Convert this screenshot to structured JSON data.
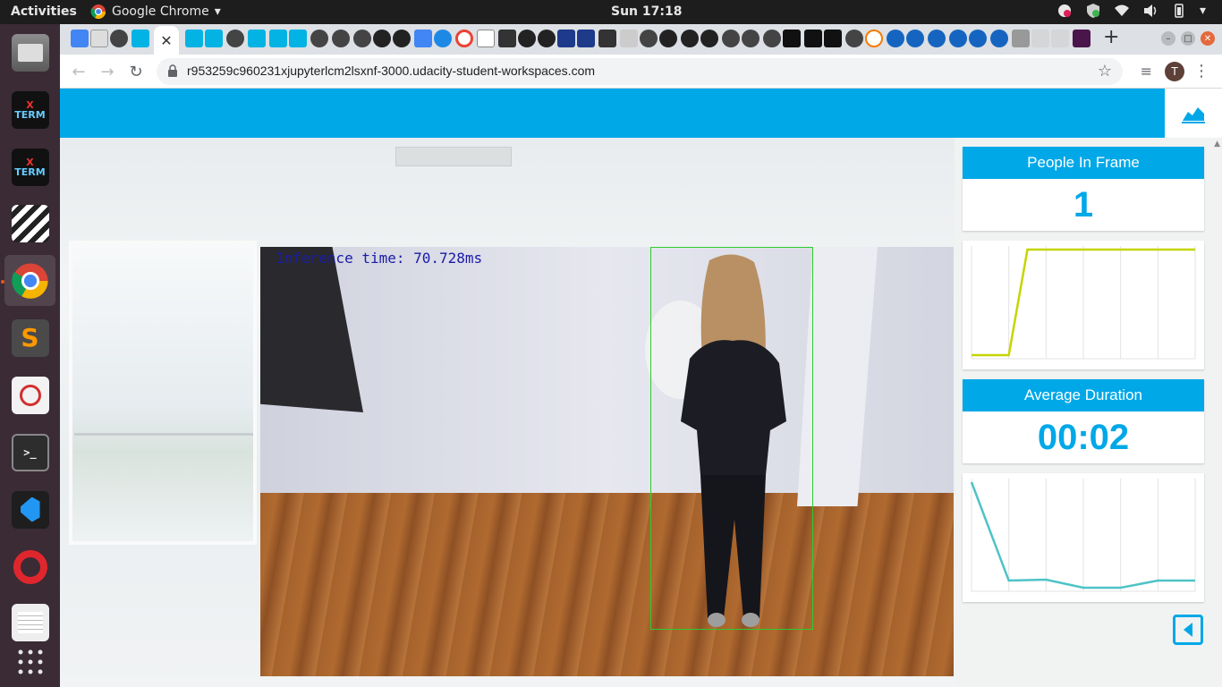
{
  "system": {
    "activities_label": "Activities",
    "app_name": "Google Chrome",
    "clock": "Sun 17:18"
  },
  "dock": {
    "items": [
      "Files",
      "XTerm",
      "XTerm",
      "Video Editor",
      "Google Chrome",
      "Sublime Text",
      "Document Viewer",
      "Terminal",
      "Visual Studio Code",
      "Opera",
      "Text Editor",
      "Show Applications"
    ],
    "xterm_label_top": "X",
    "xterm_label_bottom": "TERM"
  },
  "browser": {
    "current_tab_close": "✕",
    "new_tab": "+",
    "url": "r953259c960231xjupyterlcm2lsxnf-3000.udacity-student-workspaces.com",
    "profile_initial": "T"
  },
  "video": {
    "inference_text": "Inference time: 70.728ms"
  },
  "stats": {
    "people_title": "People In Frame",
    "people_value": "1",
    "duration_title": "Average Duration",
    "duration_value": "00:02"
  },
  "chart_data": [
    {
      "type": "line",
      "x": [
        0,
        1,
        2,
        3,
        4,
        5,
        6,
        7,
        8,
        9,
        10,
        11,
        12
      ],
      "values": [
        0,
        0,
        0,
        1,
        1,
        1,
        1,
        1,
        1,
        1,
        1,
        1,
        1
      ],
      "color": "#c5d500",
      "grid": true
    },
    {
      "type": "line",
      "x": [
        0,
        1,
        2,
        3,
        4,
        5,
        6
      ],
      "values": [
        12,
        1,
        1.1,
        0.2,
        0.2,
        1,
        1
      ],
      "color": "#4ec3c7",
      "grid": true
    }
  ],
  "colors": {
    "accent": "#00a8e8",
    "bbox": "#2ecc2e",
    "inference_text": "#1a1aa8"
  }
}
